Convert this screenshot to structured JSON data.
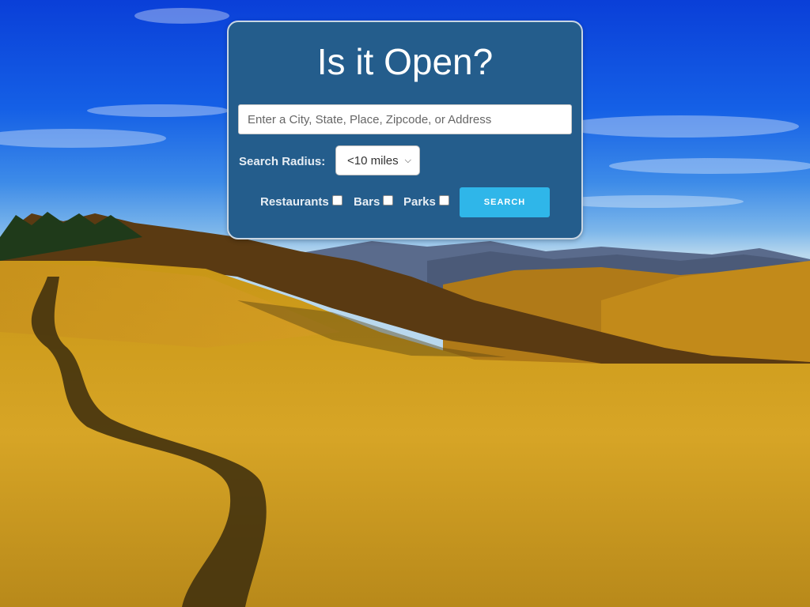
{
  "app": {
    "title": "Is it Open?"
  },
  "search": {
    "placeholder": "Enter a City, State, Place, Zipcode, or Address",
    "value": ""
  },
  "radius": {
    "label": "Search Radius:",
    "selected": "<10 miles"
  },
  "filters": [
    {
      "label": "Restaurants",
      "checked": false
    },
    {
      "label": "Bars",
      "checked": false
    },
    {
      "label": "Parks",
      "checked": false
    }
  ],
  "actions": {
    "search_label": "SEARCH"
  },
  "colors": {
    "panel": "#245d8c",
    "button": "#2fb6e9",
    "sky": "#1560e6",
    "field": "#c99a1c"
  },
  "icons": {
    "select_arrow": "chevron-down-icon"
  }
}
